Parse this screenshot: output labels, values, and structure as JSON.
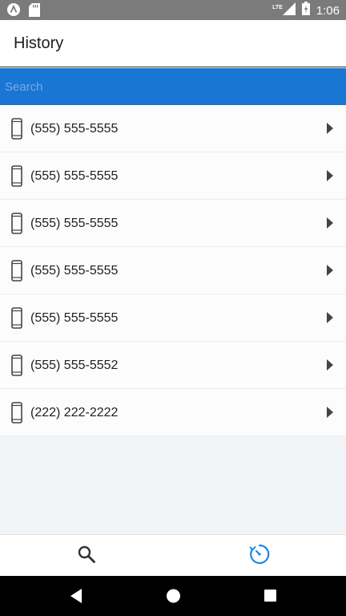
{
  "status_bar": {
    "time": "1:06",
    "network": "LTE",
    "icons": [
      "app-notification-icon",
      "sd-card-icon",
      "signal-icon",
      "battery-charging-icon"
    ]
  },
  "header": {
    "title": "History"
  },
  "search": {
    "placeholder": "Search",
    "value": ""
  },
  "history": {
    "items": [
      {
        "number": "(555) 555-5555",
        "icon": "mobile-phone-icon"
      },
      {
        "number": "(555) 555-5555",
        "icon": "mobile-phone-icon"
      },
      {
        "number": "(555) 555-5555",
        "icon": "mobile-phone-icon"
      },
      {
        "number": "(555) 555-5555",
        "icon": "mobile-phone-icon"
      },
      {
        "number": "(555) 555-5555",
        "icon": "mobile-phone-icon"
      },
      {
        "number": "(555) 555-5552",
        "icon": "mobile-phone-icon"
      },
      {
        "number": "(222) 222-2222",
        "icon": "mobile-phone-icon"
      }
    ]
  },
  "tab_bar": {
    "tabs": [
      {
        "icon": "search-icon",
        "active": false
      },
      {
        "icon": "history-icon",
        "active": true
      }
    ],
    "active_color": "#1e88e5"
  },
  "nav_bar": {
    "buttons": [
      "back-icon",
      "home-icon",
      "recents-icon"
    ]
  },
  "colors": {
    "status_bar": "#7b7b7b",
    "search_bar": "#1976d2",
    "background": "#f2f5f8"
  }
}
